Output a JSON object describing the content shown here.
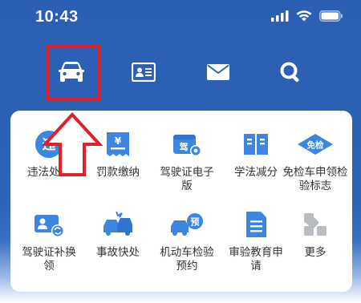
{
  "status": {
    "time": "10:43"
  },
  "nav": {
    "items": [
      {
        "name": "vehicle",
        "icon": "car-icon"
      },
      {
        "name": "license",
        "icon": "id-card-icon"
      },
      {
        "name": "messages",
        "icon": "mail-icon"
      },
      {
        "name": "search",
        "icon": "search-icon"
      }
    ]
  },
  "services": [
    {
      "label": "违法处理",
      "icon": "violation-icon",
      "badge": "违"
    },
    {
      "label": "罚款缴纳",
      "icon": "fine-payment-icon",
      "badge": "¥"
    },
    {
      "label": "驾驶证电子版",
      "icon": "e-license-icon",
      "badge": "驾"
    },
    {
      "label": "学法减分",
      "icon": "book-icon",
      "badge": ""
    },
    {
      "label": "免检车申领检验标志",
      "icon": "exempt-inspection-icon",
      "badge": "免检"
    },
    {
      "label": "驾驶证补换领",
      "icon": "license-renew-icon",
      "badge": ""
    },
    {
      "label": "事故快处",
      "icon": "accident-icon",
      "badge": ""
    },
    {
      "label": "机动车检验预约",
      "icon": "inspection-booking-icon",
      "badge": "预"
    },
    {
      "label": "审验教育申请",
      "icon": "document-icon",
      "badge": ""
    },
    {
      "label": "更多",
      "icon": "more-icon",
      "badge": ""
    }
  ],
  "colors": {
    "brand": "#2d62b5",
    "accent": "#e0202a",
    "icon_blue": "#3a86e0"
  }
}
